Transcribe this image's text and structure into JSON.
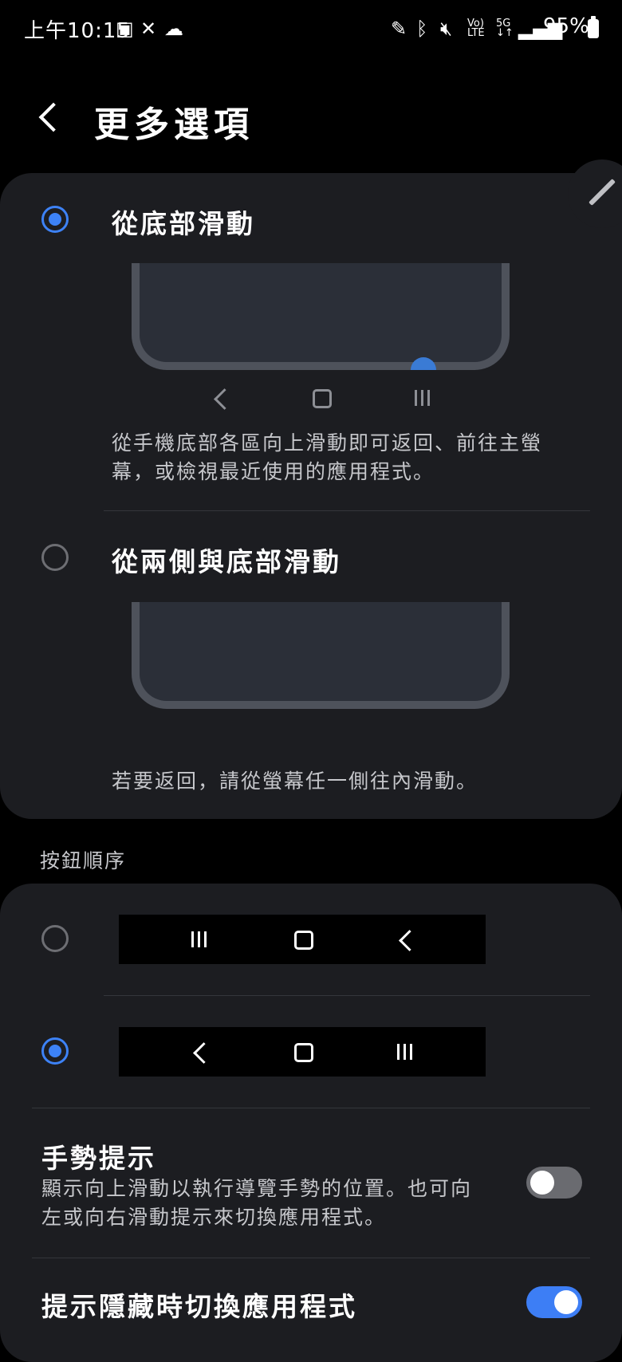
{
  "status_bar": {
    "time": "上午10:15",
    "left_icons": [
      "gallery-icon",
      "x-icon",
      "cloud-sync-icon"
    ],
    "right_icons": [
      "pen-icon",
      "bluetooth-icon",
      "mute-icon",
      "volte-icon",
      "5g-icon",
      "signal-icon"
    ],
    "battery_text": "95%"
  },
  "header": {
    "title": "更多選項"
  },
  "gesture_options": [
    {
      "label": "從底部滑動",
      "selected": true,
      "description": "從手機底部各區向上滑動即可返回、前往主螢幕，或檢視最近使用的應用程式。"
    },
    {
      "label": "從兩側與底部滑動",
      "selected": false,
      "description": "若要返回，請從螢幕任一側往內滑動。"
    }
  ],
  "button_order": {
    "section_title": "按鈕順序",
    "options": [
      {
        "order": [
          "recents",
          "home",
          "back"
        ],
        "selected": false
      },
      {
        "order": [
          "back",
          "home",
          "recents"
        ],
        "selected": true
      }
    ]
  },
  "gesture_hint": {
    "title": "手勢提示",
    "description": "顯示向上滑動以執行導覽手勢的位置。也可向左或向右滑動提示來切換應用程式。",
    "enabled": false
  },
  "switch_apps_hidden": {
    "title": "提示隱藏時切換應用程式",
    "enabled": true
  },
  "colors": {
    "accent": "#3d82f6",
    "card": "#1c1d21",
    "background": "#000000"
  }
}
